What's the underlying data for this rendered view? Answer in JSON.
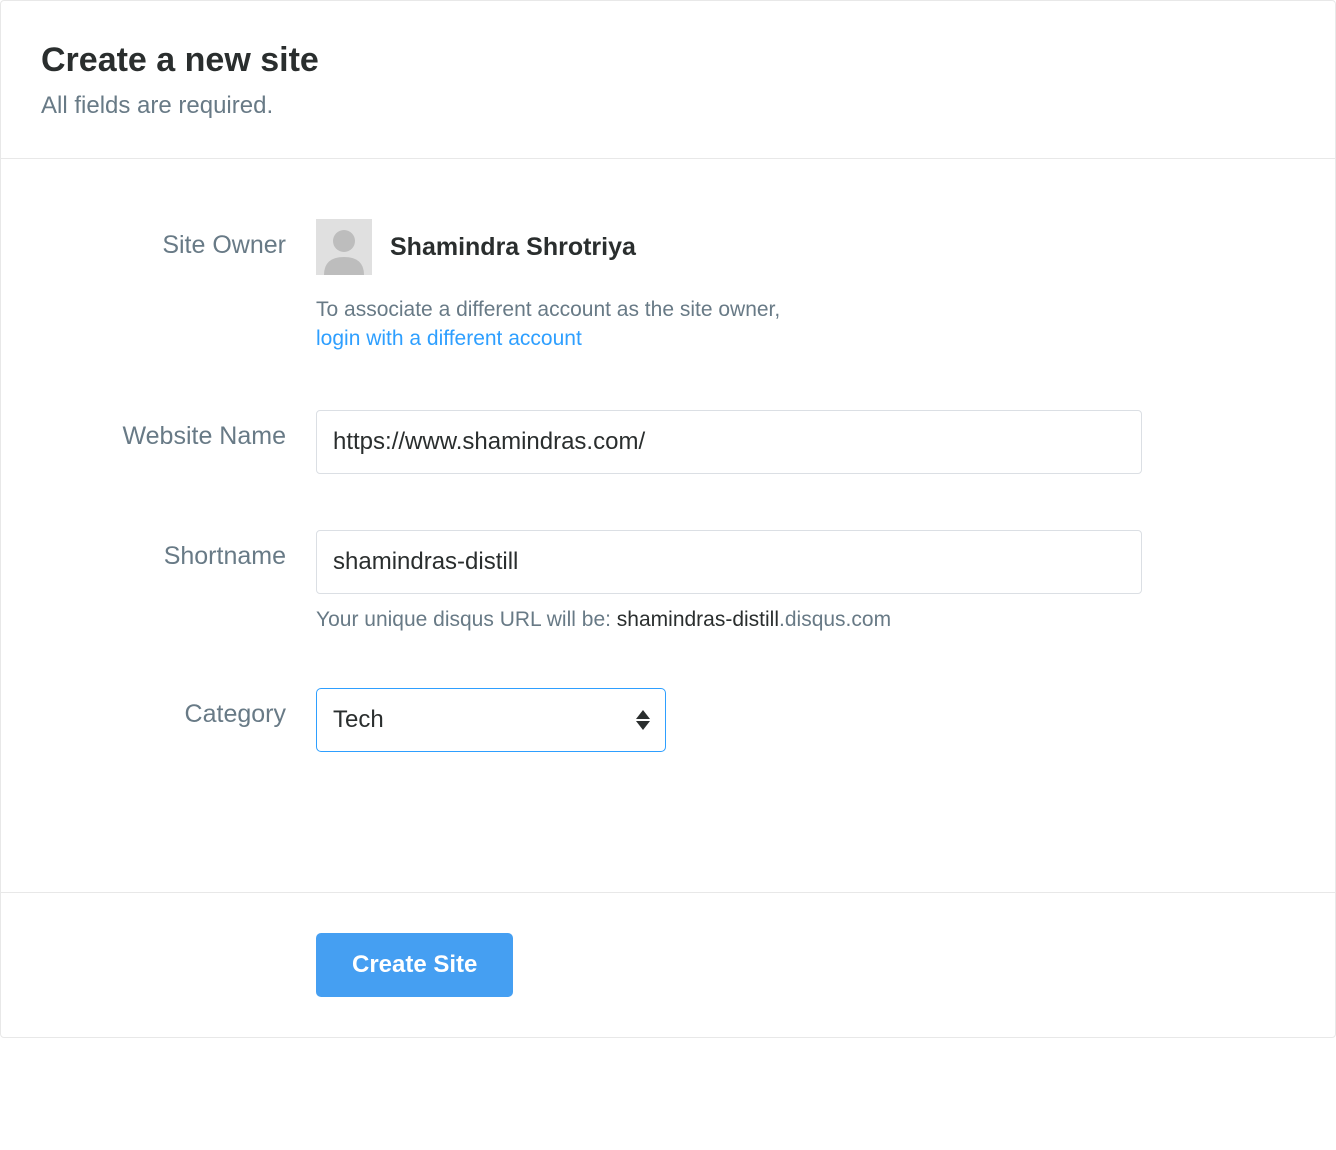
{
  "header": {
    "title": "Create a new site",
    "subtitle": "All fields are required."
  },
  "form": {
    "site_owner": {
      "label": "Site Owner",
      "name": "Shamindra Shrotriya",
      "help_text": "To associate a different account as the site owner,",
      "link_text": "login with a different account"
    },
    "website_name": {
      "label": "Website Name",
      "value": "https://www.shamindras.com/"
    },
    "shortname": {
      "label": "Shortname",
      "value": "shamindras-distill",
      "helper_prefix": "Your unique disqus URL will be: ",
      "helper_strong": "shamindras-distill",
      "helper_suffix": ".disqus.com"
    },
    "category": {
      "label": "Category",
      "selected": "Tech"
    }
  },
  "actions": {
    "create_label": "Create Site"
  }
}
